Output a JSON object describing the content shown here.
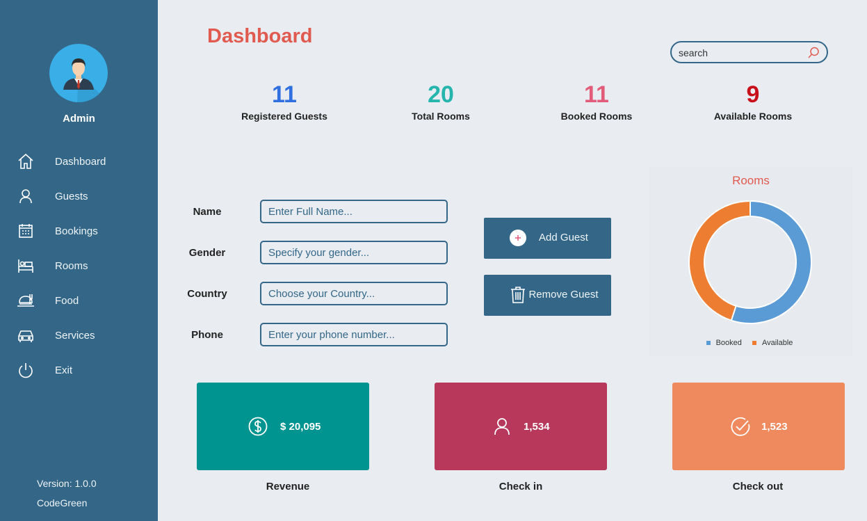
{
  "sidebar": {
    "user": "Admin",
    "items": [
      {
        "label": "Dashboard",
        "icon": "home-icon"
      },
      {
        "label": "Guests",
        "icon": "user-icon"
      },
      {
        "label": "Bookings",
        "icon": "calendar-icon"
      },
      {
        "label": "Rooms",
        "icon": "bed-icon"
      },
      {
        "label": "Food",
        "icon": "food-icon"
      },
      {
        "label": "Services",
        "icon": "car-icon"
      },
      {
        "label": "Exit",
        "icon": "power-icon"
      }
    ],
    "version": "Version: 1.0.0",
    "company": "CodeGreen"
  },
  "header": {
    "title": "Dashboard",
    "search_placeholder": "search"
  },
  "stats": [
    {
      "value": "11",
      "label": "Registered Guests",
      "color": "#2f6fe0"
    },
    {
      "value": "20",
      "label": "Total Rooms",
      "color": "#26b5ad"
    },
    {
      "value": "11",
      "label": "Booked Rooms",
      "color": "#e25c7a"
    },
    {
      "value": "9",
      "label": "Available Rooms",
      "color": "#c8101a"
    }
  ],
  "form": {
    "name": {
      "label": "Name",
      "placeholder": "Enter Full Name..."
    },
    "gender": {
      "label": "Gender",
      "placeholder": "Specify your gender..."
    },
    "country": {
      "label": "Country",
      "placeholder": "Choose your Country..."
    },
    "phone": {
      "label": "Phone",
      "placeholder": "Enter your phone number..."
    }
  },
  "actions": {
    "add": "Add Guest",
    "remove": "Remove Guest"
  },
  "chart_data": {
    "type": "pie",
    "title": "Rooms",
    "categories": [
      "Booked",
      "Available"
    ],
    "values": [
      11,
      9
    ],
    "colors": [
      "#5b9bd5",
      "#ed7d31"
    ],
    "legend": "bottom"
  },
  "cards": [
    {
      "value": "$ 20,095",
      "label": "Revenue",
      "color": "#009490",
      "icon": "dollar-icon"
    },
    {
      "value": "1,534",
      "label": "Check in",
      "color": "#b8385c",
      "icon": "user-icon"
    },
    {
      "value": "1,523",
      "label": "Check out",
      "color": "#ef895e",
      "icon": "check-circle-icon"
    }
  ]
}
